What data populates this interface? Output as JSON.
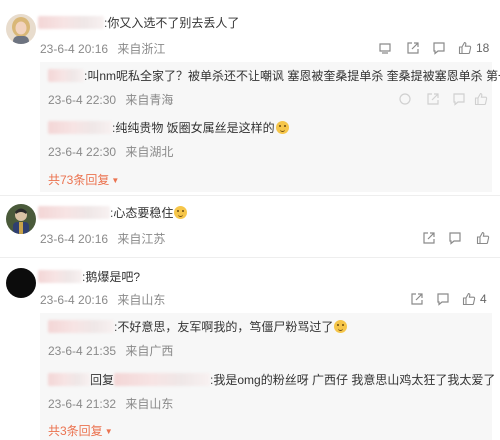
{
  "comments": [
    {
      "text": ":你又入选不了别去丢人了",
      "time": "23-6-4 20:16",
      "location": "来自浙江",
      "likes": "18",
      "replies": [
        {
          "text": ":叫nm呢私全家了？被单杀还不让嘲讽 塞恩被奎桑提单杀 奎桑提被塞恩单杀 第一人",
          "time": "23-6-4 22:30",
          "location": "来自青海"
        },
        {
          "text": ":纯纯贵物 饭圈女属丝是这样的",
          "time": "23-6-4 22:30",
          "location": "来自湖北"
        }
      ],
      "more": "共73条回复"
    },
    {
      "text": ":心态要稳住",
      "time": "23-6-4 20:16",
      "location": "来自江苏"
    },
    {
      "text": ":鹅爆是吧?",
      "time": "23-6-4 20:16",
      "location": "来自山东",
      "likes": "4",
      "replies": [
        {
          "text": ":不好意思，友军啊我的，笃僵尸粉骂过了",
          "time": "23-6-4 21:35",
          "location": "来自广西"
        },
        {
          "prefix": "回复",
          "text": ":我是omg的粉丝呀 广西仔 我意思山鸡太狂了我太爱了",
          "time": "23-6-4 21:32",
          "location": "来自山东"
        }
      ],
      "more": "共3条回复"
    }
  ],
  "icons": {
    "share": "share-icon",
    "comment": "comment-icon",
    "like": "thumb-up-icon",
    "avatar_1": "avatar-blonde-woman",
    "avatar_2": "avatar-character",
    "avatar_3": "avatar-black"
  },
  "colors": {
    "link_orange": "#eb7350",
    "meta_gray": "#8a8a8a",
    "reply_bg": "#f7f7f7"
  }
}
